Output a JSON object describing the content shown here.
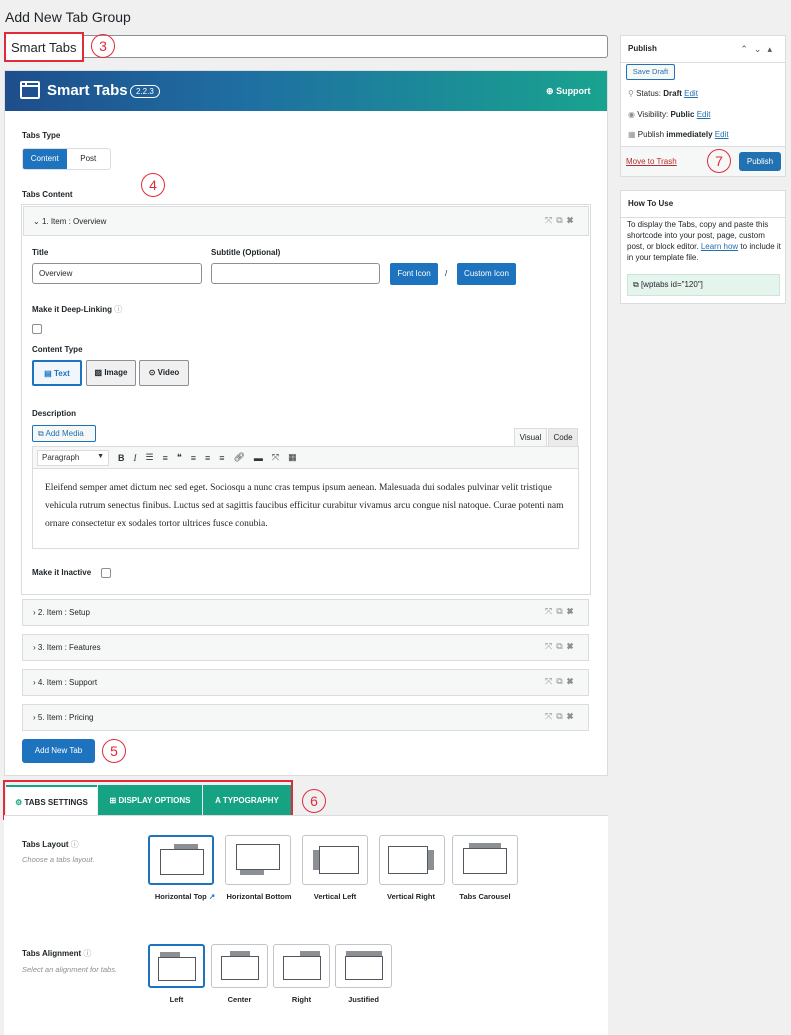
{
  "page_title": "Add New Tab Group",
  "title_value": "Smart Tabs",
  "brand": {
    "name": "Smart Tabs",
    "version": "2.2.3",
    "support": "Support"
  },
  "tabs_type": {
    "label": "Tabs Type",
    "options": [
      "Content",
      "Post"
    ],
    "selected": "Content"
  },
  "tabs_content_label": "Tabs Content",
  "items": [
    {
      "label": "1. Item : Overview",
      "expanded": true
    },
    {
      "label": "2. Item : Setup"
    },
    {
      "label": "3. Item : Features"
    },
    {
      "label": "4. Item : Support"
    },
    {
      "label": "5. Item : Pricing"
    }
  ],
  "item_fields": {
    "title_label": "Title",
    "title_value": "Overview",
    "subtitle_label": "Subtitle (Optional)",
    "subtitle_value": "",
    "font_icon": "Font Icon",
    "separator": "/",
    "custom_icon": "Custom Icon",
    "deep_link_label": "Make it Deep-Linking",
    "content_type_label": "Content Type",
    "content_types": [
      "Text",
      "Image",
      "Video"
    ],
    "content_type_selected": "Text",
    "description_label": "Description",
    "add_media": "Add Media",
    "visual_tab": "Visual",
    "code_tab": "Code",
    "format_select": "Paragraph",
    "description_text": "Eleifend semper amet dictum nec sed eget. Sociosqu a nunc cras tempus ipsum aenean. Malesuada dui sodales pulvinar velit tristique vehicula rutrum senectus finibus. Luctus sed at sagittis faucibus efficitur curabitur vivamus arcu congue nisl natoque. Curae potenti nam ornare consectetur ex sodales tortor ultrices fusce conubia.",
    "inactive_label": "Make it Inactive"
  },
  "add_new_tab": "Add New Tab",
  "settings_tabs": [
    "TABS SETTINGS",
    "DISPLAY OPTIONS",
    "TYPOGRAPHY"
  ],
  "tabs_layout": {
    "label": "Tabs Layout",
    "hint": "Choose a tabs layout.",
    "options": [
      "Horizontal Top",
      "Horizontal Bottom",
      "Vertical Left",
      "Vertical Right",
      "Tabs Carousel"
    ],
    "selected": "Horizontal Top"
  },
  "tabs_alignment": {
    "label": "Tabs Alignment",
    "hint": "Select an alignment for tabs.",
    "options": [
      "Left",
      "Center",
      "Right",
      "Justified"
    ],
    "selected": "Left"
  },
  "publish": {
    "title": "Publish",
    "save_draft": "Save Draft",
    "status_label": "Status:",
    "status_value": "Draft",
    "visibility_label": "Visibility:",
    "visibility_value": "Public",
    "publish_label": "Publish",
    "publish_value": "immediately",
    "edit": "Edit",
    "move_to_trash": "Move to Trash",
    "publish_button": "Publish"
  },
  "how_to_use": {
    "title": "How To Use",
    "text_before": "To display the Tabs, copy and paste this shortcode into your post, page, custom post, or block editor.",
    "link": "Learn how",
    "text_after": "to include it in your template file.",
    "shortcode": "[wptabs id=\"120\"]"
  },
  "annotations": [
    "3",
    "4",
    "5",
    "6",
    "7"
  ],
  "colors": {
    "accent": "#1e73be",
    "teal": "#15a383",
    "annotation": "#e02b3a"
  }
}
